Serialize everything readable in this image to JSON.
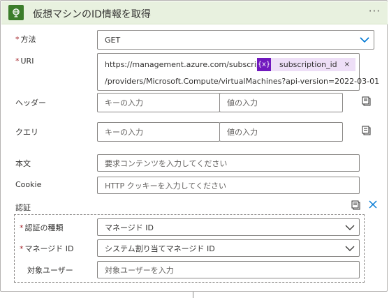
{
  "action": {
    "title": "仮想マシンのID情報を取得",
    "more_label": "···",
    "icon": "globe-icon",
    "header_color": "#e8f1df",
    "icon_color": "#3b7d2a"
  },
  "fields": {
    "method": {
      "label": "方法",
      "required_mark": "*",
      "value": "GET"
    },
    "uri": {
      "label": "URI",
      "required_mark": "*",
      "text_before": "https://management.azure.com/subscriptions/",
      "token_icon": "{x}",
      "token_label": "subscription_id",
      "token_remove": "×",
      "text_after": "/providers/Microsoft.Compute/virtualMachines?api-version=2022-03-01",
      "token_color": "#7119be"
    },
    "headers": {
      "label": "ヘッダー",
      "key_placeholder": "キーの入力",
      "value_placeholder": "値の入力"
    },
    "queries": {
      "label": "クエリ",
      "key_placeholder": "キーの入力",
      "value_placeholder": "値の入力"
    },
    "body": {
      "label": "本文",
      "placeholder": "要求コンテンツを入力してください"
    },
    "cookie": {
      "label": "Cookie",
      "placeholder": "HTTP クッキーを入力してください"
    }
  },
  "auth": {
    "label": "認証",
    "type": {
      "label": "認証の種類",
      "required_mark": "*",
      "value": "マネージド ID"
    },
    "managed_identity": {
      "label": "マネージド ID",
      "required_mark": "*",
      "value": "システム割り当てマネージド ID"
    },
    "audience": {
      "label": "対象ユーザー",
      "placeholder": "対象ユーザーを入力"
    },
    "close_label": "✕"
  },
  "colors": {
    "required": "#a4262c",
    "accent": "#0078d4"
  }
}
